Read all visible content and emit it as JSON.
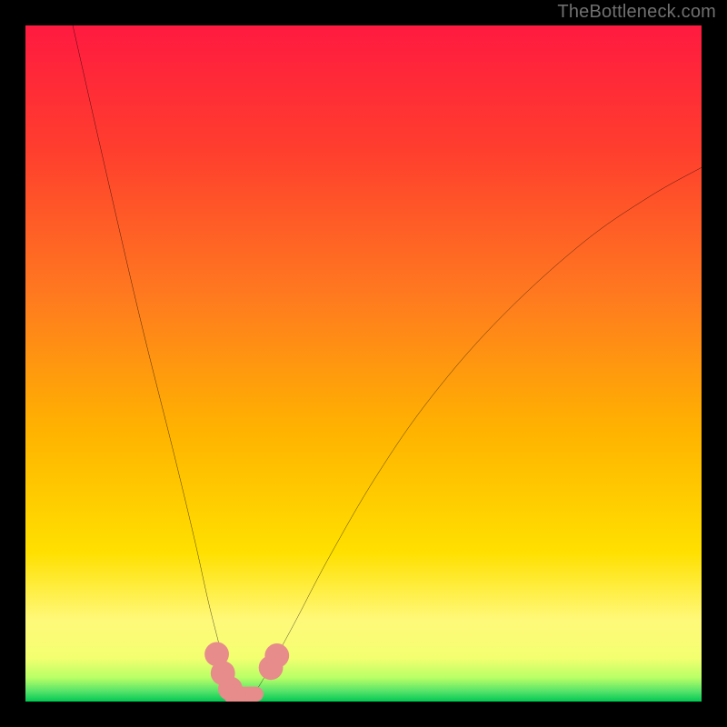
{
  "watermark": {
    "text": "TheBottleneck.com"
  },
  "chart_data": {
    "type": "line",
    "title": "",
    "xlabel": "",
    "ylabel": "",
    "xlim": [
      0,
      100
    ],
    "ylim": [
      0,
      100
    ],
    "grid": false,
    "gradient_stops": [
      {
        "offset": 0,
        "color": "#ff1a40"
      },
      {
        "offset": 0.18,
        "color": "#ff3d2e"
      },
      {
        "offset": 0.4,
        "color": "#ff7a1f"
      },
      {
        "offset": 0.6,
        "color": "#ffb300"
      },
      {
        "offset": 0.78,
        "color": "#ffe000"
      },
      {
        "offset": 0.88,
        "color": "#fff97a"
      },
      {
        "offset": 0.935,
        "color": "#f4ff70"
      },
      {
        "offset": 0.965,
        "color": "#b8ff66"
      },
      {
        "offset": 0.985,
        "color": "#55e36a"
      },
      {
        "offset": 1.0,
        "color": "#00c853"
      }
    ],
    "series": [
      {
        "name": "left-branch",
        "x": [
          7.0,
          12.0,
          17.0,
          22.0,
          25.0,
          27.0,
          28.5,
          29.5,
          30.2,
          31.0
        ],
        "y": [
          100.0,
          78.0,
          56.5,
          36.5,
          24.0,
          15.0,
          9.0,
          5.0,
          2.0,
          0.0
        ]
      },
      {
        "name": "right-branch",
        "x": [
          33.0,
          34.5,
          37.0,
          40.0,
          45.0,
          52.0,
          60.0,
          70.0,
          82.0,
          92.0,
          100.0
        ],
        "y": [
          0.0,
          2.2,
          6.5,
          12.0,
          21.5,
          33.5,
          45.0,
          56.5,
          67.5,
          74.5,
          79.0
        ]
      }
    ],
    "floor_marks": {
      "name": "valley-markers",
      "color": "#e78b8b",
      "points": [
        {
          "x": 28.3,
          "y": 7.0,
          "r": 1.8
        },
        {
          "x": 29.2,
          "y": 4.2,
          "r": 1.8
        },
        {
          "x": 30.3,
          "y": 1.9,
          "r": 1.8
        },
        {
          "x": 31.0,
          "y": 0.9,
          "r": 1.6
        },
        {
          "x": 36.3,
          "y": 5.0,
          "r": 1.8
        },
        {
          "x": 37.2,
          "y": 6.8,
          "r": 1.8
        }
      ],
      "bar": {
        "x0": 29.7,
        "x1": 35.2,
        "y": 0.0,
        "thickness": 2.2
      }
    }
  }
}
